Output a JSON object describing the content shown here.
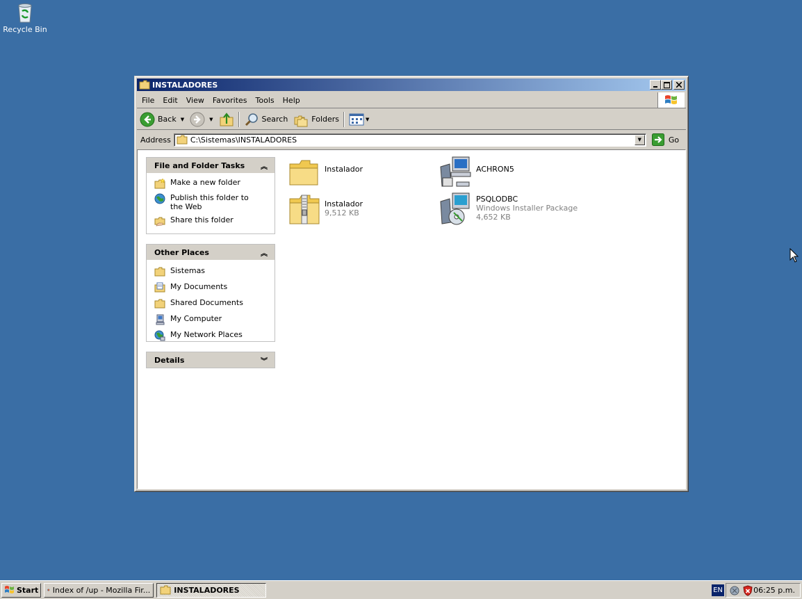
{
  "desktop": {
    "recycle_bin_label": "Recycle Bin"
  },
  "window": {
    "title": "INSTALADORES",
    "menu": [
      "File",
      "Edit",
      "View",
      "Favorites",
      "Tools",
      "Help"
    ],
    "toolbar": {
      "back": "Back",
      "search": "Search",
      "folders": "Folders"
    },
    "address": {
      "label": "Address",
      "value": "C:\\Sistemas\\INSTALADORES",
      "go": "Go"
    },
    "panels": {
      "file_tasks": {
        "title": "File and Folder Tasks",
        "items": [
          "Make a new folder",
          "Publish this folder to the Web",
          "Share this folder"
        ]
      },
      "other_places": {
        "title": "Other Places",
        "items": [
          "Sistemas",
          "My Documents",
          "Shared Documents",
          "My Computer",
          "My Network Places"
        ]
      },
      "details": {
        "title": "Details"
      }
    },
    "files": [
      {
        "name": "Instalador",
        "line2": "",
        "line3": "",
        "icon": "folder-icon"
      },
      {
        "name": "ACHRON5",
        "line2": "",
        "line3": "",
        "icon": "setup-program-icon"
      },
      {
        "name": "Instalador",
        "line2": "9,512 KB",
        "line3": "",
        "icon": "zip-folder-icon"
      },
      {
        "name": "PSQLODBC",
        "line2": "Windows Installer Package",
        "line3": "4,652 KB",
        "icon": "installer-package-icon"
      }
    ]
  },
  "taskbar": {
    "start": "Start",
    "tasks": [
      "Index of /up - Mozilla Fir...",
      "INSTALADORES"
    ],
    "language": "EN",
    "clock": "06:25 p.m."
  },
  "colors": {
    "desktop": "#3a6ea5",
    "titlebar": "#0a246a",
    "face": "#d4d0c8"
  }
}
